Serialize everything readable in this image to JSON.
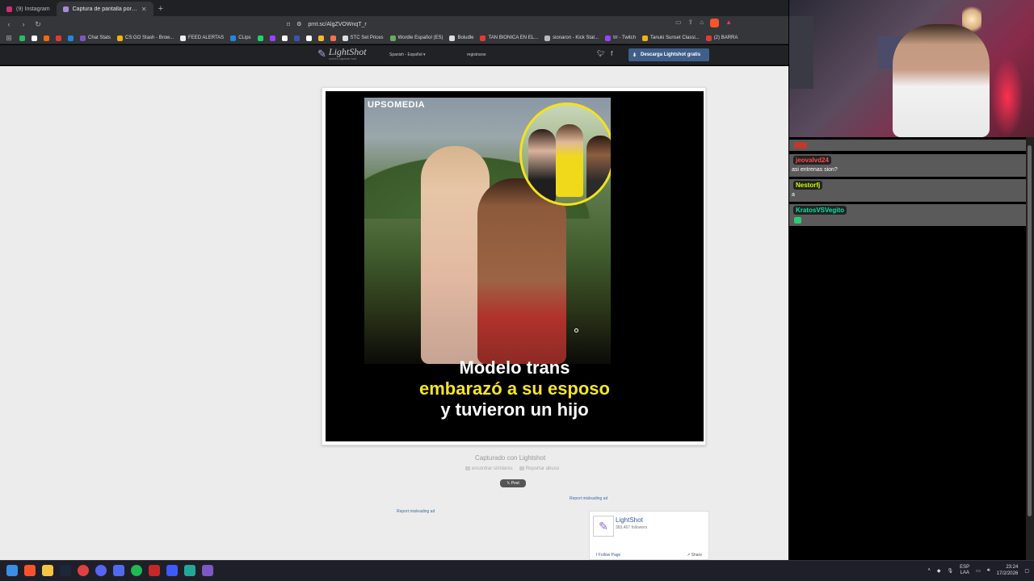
{
  "browser": {
    "tabs": [
      {
        "label": "(9) Instagram",
        "active": false
      },
      {
        "label": "Captura de pantalla por Lightshot",
        "active": true
      }
    ],
    "url": "prnt.sc/AlgZVOWnqT_r",
    "bookmarks": [
      {
        "label": "",
        "color": "#21c063"
      },
      {
        "label": "",
        "color": "#ffffff"
      },
      {
        "label": "",
        "color": "#ff6a00"
      },
      {
        "label": "",
        "color": "#e53935"
      },
      {
        "label": "",
        "color": "#1e88e5"
      },
      {
        "label": "Chat Stats",
        "color": "#7e57c2"
      },
      {
        "label": "CS:GO Stash - Brow...",
        "color": "#f4b400"
      },
      {
        "label": "FEED ALERTAS",
        "color": "#eeeeee"
      },
      {
        "label": "CLips",
        "color": "#1e88e5"
      },
      {
        "label": "",
        "color": "#1ed760"
      },
      {
        "label": "",
        "color": "#9146ff"
      },
      {
        "label": "",
        "color": "#ffffff"
      },
      {
        "label": "",
        "color": "#3f51b5"
      },
      {
        "label": "",
        "color": "#ffffff"
      },
      {
        "label": "",
        "color": "#f3ba2f"
      },
      {
        "label": "",
        "color": "#ff7043"
      },
      {
        "label": "STC Set Prices",
        "color": "#dddddd"
      },
      {
        "label": "Wordle Español (ES)",
        "color": "#6aaa64"
      },
      {
        "label": "Boludle",
        "color": "#dddddd"
      },
      {
        "label": "TAN BIONICA EN EL...",
        "color": "#e53935"
      },
      {
        "label": "sionaron - Kick Stat...",
        "color": "#bbbbbb"
      },
      {
        "label": "trr - Twitch",
        "color": "#9146ff"
      },
      {
        "label": "Tanuki Sunset Classi...",
        "color": "#f4b400"
      },
      {
        "label": "(2) BARRA",
        "color": "#e53935"
      }
    ]
  },
  "lightshot": {
    "logo": "LightShot",
    "tagline": "screen capture tool",
    "language": "Spanish - Español",
    "register": "registrarse",
    "download_button": "Descarga Lightshot gratis",
    "captured_with": "Capturado con Lightshot",
    "find_similar": "encontrar similares",
    "report_abuse": "Reportar abuso",
    "x_post": "𝕏 Post",
    "report_ad_1": "Report misleading ad",
    "report_ad_2": "Report misleading ad",
    "fb": {
      "name": "LightShot",
      "followers": "383,467 followers",
      "follow": "Follow Page",
      "share": "Share"
    }
  },
  "screenshot": {
    "brand": "UPSOMEDIA",
    "headline_line1": "Modelo trans",
    "headline_line2": "embarazó a su esposo",
    "headline_line3": "y tuvieron un hijo"
  },
  "chat": {
    "messages": [
      {
        "user": "jeovalvd24",
        "user_color": "#ff4d4d",
        "text": "asi entrenas sion?"
      },
      {
        "user": "Nestorfj",
        "user_color": "#c8ff00",
        "text": "a"
      },
      {
        "user": "KratosVSVegito",
        "user_color": "#00e5a0",
        "text": ""
      }
    ]
  },
  "taskbar": {
    "lang_line1": "ESP",
    "lang_line2": "LAA",
    "time": "23:24",
    "date": "17/2/2026"
  }
}
